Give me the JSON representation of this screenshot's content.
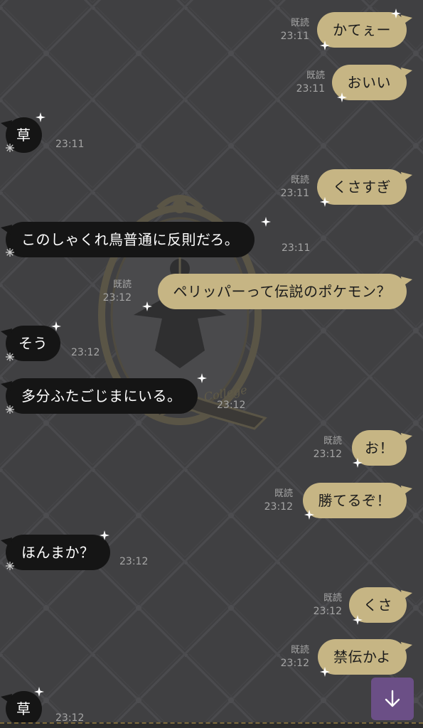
{
  "messages": [
    {
      "dir": "out",
      "text": "かてぇー",
      "read": "既読",
      "time": "23:11"
    },
    {
      "dir": "out",
      "text": "おいい",
      "read": "既読",
      "time": "23:11"
    },
    {
      "dir": "in",
      "text": "草",
      "time": "23:11"
    },
    {
      "dir": "out",
      "text": "くさすぎ",
      "read": "既読",
      "time": "23:11"
    },
    {
      "dir": "in",
      "text": "このしゃくれ鳥普通に反則だろ。",
      "time": "23:11"
    },
    {
      "dir": "out",
      "text": "ペリッパーって伝説のポケモン？",
      "read": "既読",
      "time": "23:12"
    },
    {
      "dir": "in",
      "text": "そう",
      "time": "23:12"
    },
    {
      "dir": "in",
      "text": "多分ふたごじまにいる。",
      "time": "23:12"
    },
    {
      "dir": "out",
      "text": "お！",
      "read": "既読",
      "time": "23:12"
    },
    {
      "dir": "out",
      "text": "勝てるぞ！",
      "read": "既読",
      "time": "23:12"
    },
    {
      "dir": "in",
      "text": "ほんまか？",
      "time": "23:12"
    },
    {
      "dir": "out",
      "text": "くさ",
      "read": "既読",
      "time": "23:12"
    },
    {
      "dir": "out",
      "text": "禁伝かよ",
      "read": "既読",
      "time": "23:12"
    },
    {
      "dir": "in",
      "text": "草",
      "time": "23:12"
    }
  ],
  "background": {
    "emblem_text": "College"
  },
  "controls": {
    "scroll_down_icon": "arrow-down-icon"
  },
  "colors": {
    "background": "#404042",
    "outgoing_bubble": "#c6b584",
    "incoming_bubble": "#151515",
    "scroll_button": "#6b4f86",
    "meta_text": "#a5a5a5"
  }
}
